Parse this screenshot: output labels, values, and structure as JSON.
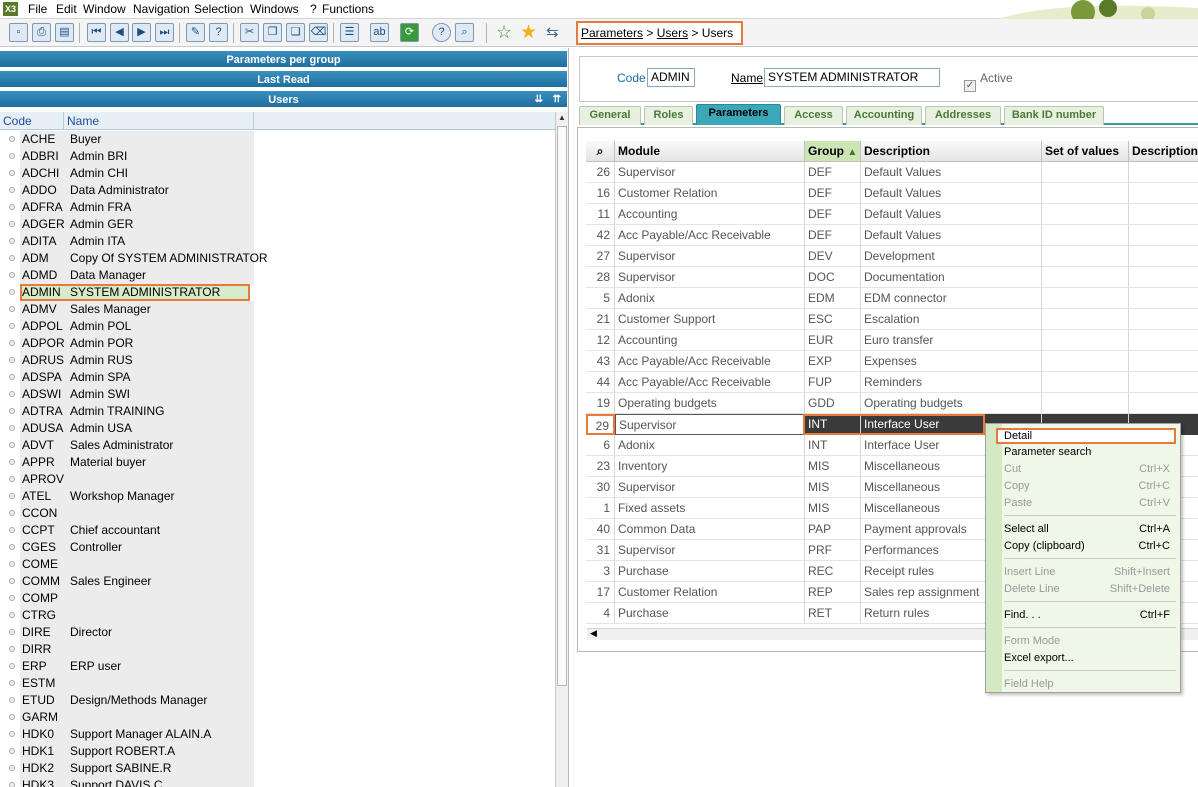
{
  "menu": [
    "File",
    "Edit",
    "Window",
    "Navigation",
    "Selection",
    "Windows",
    "?",
    "Functions"
  ],
  "breadcrumb": {
    "p1": "Parameters",
    "sep1": ">",
    "p2": "Users",
    "sep2": ">",
    "p3": "Users"
  },
  "left": {
    "sections": [
      "Parameters per group",
      "Last Read",
      "Users"
    ],
    "col_code": "Code",
    "col_name": "Name",
    "rows": [
      [
        "ACHE",
        "Buyer"
      ],
      [
        "ADBRI",
        "Admin BRI"
      ],
      [
        "ADCHI",
        "Admin CHI"
      ],
      [
        "ADDO",
        "Data Administrator"
      ],
      [
        "ADFRA",
        "Admin FRA"
      ],
      [
        "ADGER",
        "Admin GER"
      ],
      [
        "ADITA",
        "Admin ITA"
      ],
      [
        "ADM",
        "Copy Of SYSTEM ADMINISTRATOR"
      ],
      [
        "ADMD",
        "Data Manager"
      ],
      [
        "ADMIN",
        "SYSTEM ADMINISTRATOR"
      ],
      [
        "ADMV",
        "Sales Manager"
      ],
      [
        "ADPOL",
        "Admin POL"
      ],
      [
        "ADPOR",
        "Admin POR"
      ],
      [
        "ADRUS",
        "Admin RUS"
      ],
      [
        "ADSPA",
        "Admin SPA"
      ],
      [
        "ADSWI",
        "Admin SWI"
      ],
      [
        "ADTRA",
        "Admin TRAINING"
      ],
      [
        "ADUSA",
        "Admin USA"
      ],
      [
        "ADVT",
        "Sales Administrator"
      ],
      [
        "APPR",
        "Material buyer"
      ],
      [
        "APROV",
        ""
      ],
      [
        "ATEL",
        "Workshop Manager"
      ],
      [
        "CCON",
        ""
      ],
      [
        "CCPT",
        "Chief accountant"
      ],
      [
        "CGES",
        "Controller"
      ],
      [
        "COME",
        ""
      ],
      [
        "COMM",
        "Sales Engineer"
      ],
      [
        "COMP",
        ""
      ],
      [
        "CTRG",
        ""
      ],
      [
        "DIRE",
        "Director"
      ],
      [
        "DIRR",
        ""
      ],
      [
        "ERP",
        "ERP user"
      ],
      [
        "ESTM",
        ""
      ],
      [
        "ETUD",
        "Design/Methods Manager"
      ],
      [
        "GARM",
        ""
      ],
      [
        "HDK0",
        "Support Manager ALAIN.A"
      ],
      [
        "HDK1",
        "Support ROBERT.A"
      ],
      [
        "HDK2",
        "Support SABINE.R"
      ],
      [
        "HDK3",
        "Support DAVIS.C"
      ]
    ]
  },
  "right": {
    "code_label": "Code",
    "code_value": "ADMIN",
    "name_label": "Name",
    "name_value": "SYSTEM ADMINISTRATOR",
    "active_label": "Active",
    "tabs": [
      "General",
      "Roles",
      "Parameters",
      "Access",
      "Accounting",
      "Addresses",
      "Bank ID number"
    ],
    "cols": [
      "Module",
      "Group",
      "Description",
      "Set of values",
      "Description"
    ],
    "rows": [
      [
        "26",
        "Supervisor",
        "DEF",
        "Default Values"
      ],
      [
        "16",
        "Customer Relation",
        "DEF",
        "Default Values"
      ],
      [
        "11",
        "Accounting",
        "DEF",
        "Default Values"
      ],
      [
        "42",
        "Acc Payable/Acc Receivable",
        "DEF",
        "Default Values"
      ],
      [
        "27",
        "Supervisor",
        "DEV",
        "Development"
      ],
      [
        "28",
        "Supervisor",
        "DOC",
        "Documentation"
      ],
      [
        "5",
        "Adonix",
        "EDM",
        "EDM connector"
      ],
      [
        "21",
        "Customer Support",
        "ESC",
        "Escalation"
      ],
      [
        "12",
        "Accounting",
        "EUR",
        "Euro transfer"
      ],
      [
        "43",
        "Acc Payable/Acc Receivable",
        "EXP",
        "Expenses"
      ],
      [
        "44",
        "Acc Payable/Acc Receivable",
        "FUP",
        "Reminders"
      ],
      [
        "19",
        "Operating budgets",
        "GDD",
        "Operating budgets"
      ],
      [
        "29",
        "Supervisor",
        "INT",
        "Interface User"
      ],
      [
        "6",
        "Adonix",
        "INT",
        "Interface User"
      ],
      [
        "23",
        "Inventory",
        "MIS",
        "Miscellaneous"
      ],
      [
        "30",
        "Supervisor",
        "MIS",
        "Miscellaneous"
      ],
      [
        "1",
        "Fixed assets",
        "MIS",
        "Miscellaneous"
      ],
      [
        "40",
        "Common Data",
        "PAP",
        "Payment approvals"
      ],
      [
        "31",
        "Supervisor",
        "PRF",
        "Performances"
      ],
      [
        "3",
        "Purchase",
        "REC",
        "Receipt rules"
      ],
      [
        "17",
        "Customer Relation",
        "REP",
        "Sales rep assignment"
      ],
      [
        "4",
        "Purchase",
        "RET",
        "Return rules"
      ]
    ]
  },
  "context_menu": [
    {
      "label": "Detail",
      "key": "",
      "state": "hl"
    },
    {
      "label": "Parameter search",
      "key": "",
      "state": ""
    },
    {
      "label": "Cut",
      "key": "Ctrl+X",
      "state": "dis"
    },
    {
      "label": "Copy",
      "key": "Ctrl+C",
      "state": "dis"
    },
    {
      "label": "Paste",
      "key": "Ctrl+V",
      "state": "dis"
    },
    {
      "label": "Select all",
      "key": "Ctrl+A",
      "state": ""
    },
    {
      "label": "Copy (clipboard)",
      "key": "Ctrl+C",
      "state": ""
    },
    {
      "label": "Insert Line",
      "key": "Shift+Insert",
      "state": "dis"
    },
    {
      "label": "Delete Line",
      "key": "Shift+Delete",
      "state": "dis"
    },
    {
      "label": "Find. . .",
      "key": "Ctrl+F",
      "state": ""
    },
    {
      "label": "Form Mode",
      "key": "",
      "state": "dis"
    },
    {
      "label": "Excel export...",
      "key": "",
      "state": ""
    },
    {
      "label": "Field Help",
      "key": "",
      "state": "dis"
    }
  ]
}
